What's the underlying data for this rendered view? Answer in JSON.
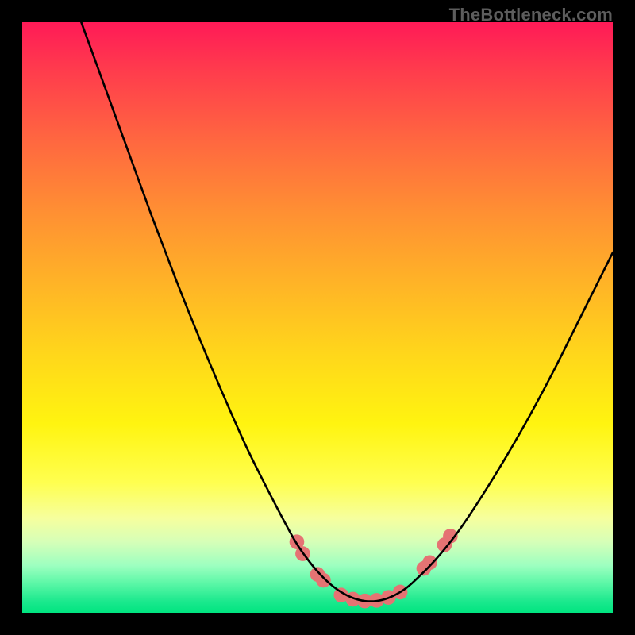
{
  "watermark": "TheBottleneck.com",
  "chart_data": {
    "type": "line",
    "title": "",
    "xlabel": "",
    "ylabel": "",
    "xlim": [
      0,
      100
    ],
    "ylim": [
      0,
      100
    ],
    "grid": false,
    "legend": false,
    "background_gradient": {
      "stops": [
        {
          "pos": 0,
          "color": "#ff1a57"
        },
        {
          "pos": 8,
          "color": "#ff3b4d"
        },
        {
          "pos": 20,
          "color": "#ff6740"
        },
        {
          "pos": 32,
          "color": "#ff8f33"
        },
        {
          "pos": 44,
          "color": "#ffb327"
        },
        {
          "pos": 56,
          "color": "#ffd61b"
        },
        {
          "pos": 68,
          "color": "#fff410"
        },
        {
          "pos": 78,
          "color": "#ffff50"
        },
        {
          "pos": 84,
          "color": "#f6ff9e"
        },
        {
          "pos": 88,
          "color": "#d6ffb8"
        },
        {
          "pos": 92,
          "color": "#9dffc0"
        },
        {
          "pos": 95,
          "color": "#5cf7a7"
        },
        {
          "pos": 98,
          "color": "#1de98e"
        },
        {
          "pos": 100,
          "color": "#00e480"
        }
      ]
    },
    "series": [
      {
        "name": "bottleneck-curve",
        "color": "#000000",
        "x": [
          10,
          14,
          18,
          22,
          26,
          30,
          34,
          38,
          42,
          46,
          48,
          50,
          52,
          54,
          56,
          58,
          60,
          62,
          64,
          66,
          70,
          74,
          78,
          82,
          86,
          90,
          94,
          98,
          100
        ],
        "y": [
          100,
          89,
          78,
          67,
          56.5,
          46.5,
          37,
          28,
          20,
          12.5,
          9.5,
          7,
          5,
          3.5,
          2.5,
          2,
          2,
          2.5,
          3.5,
          5,
          9,
          14,
          20,
          26.5,
          33.5,
          41,
          49,
          57,
          61
        ]
      }
    ],
    "markers": {
      "name": "highlight-dots",
      "color": "#e57373",
      "points": [
        {
          "x": 46.5,
          "y": 12
        },
        {
          "x": 47.5,
          "y": 10
        },
        {
          "x": 50,
          "y": 6.5
        },
        {
          "x": 51,
          "y": 5.5
        },
        {
          "x": 54,
          "y": 3
        },
        {
          "x": 56,
          "y": 2.3
        },
        {
          "x": 58,
          "y": 2
        },
        {
          "x": 60,
          "y": 2.1
        },
        {
          "x": 62,
          "y": 2.6
        },
        {
          "x": 64,
          "y": 3.5
        },
        {
          "x": 68,
          "y": 7.5
        },
        {
          "x": 69,
          "y": 8.5
        },
        {
          "x": 71.5,
          "y": 11.5
        },
        {
          "x": 72.5,
          "y": 13
        }
      ]
    }
  }
}
